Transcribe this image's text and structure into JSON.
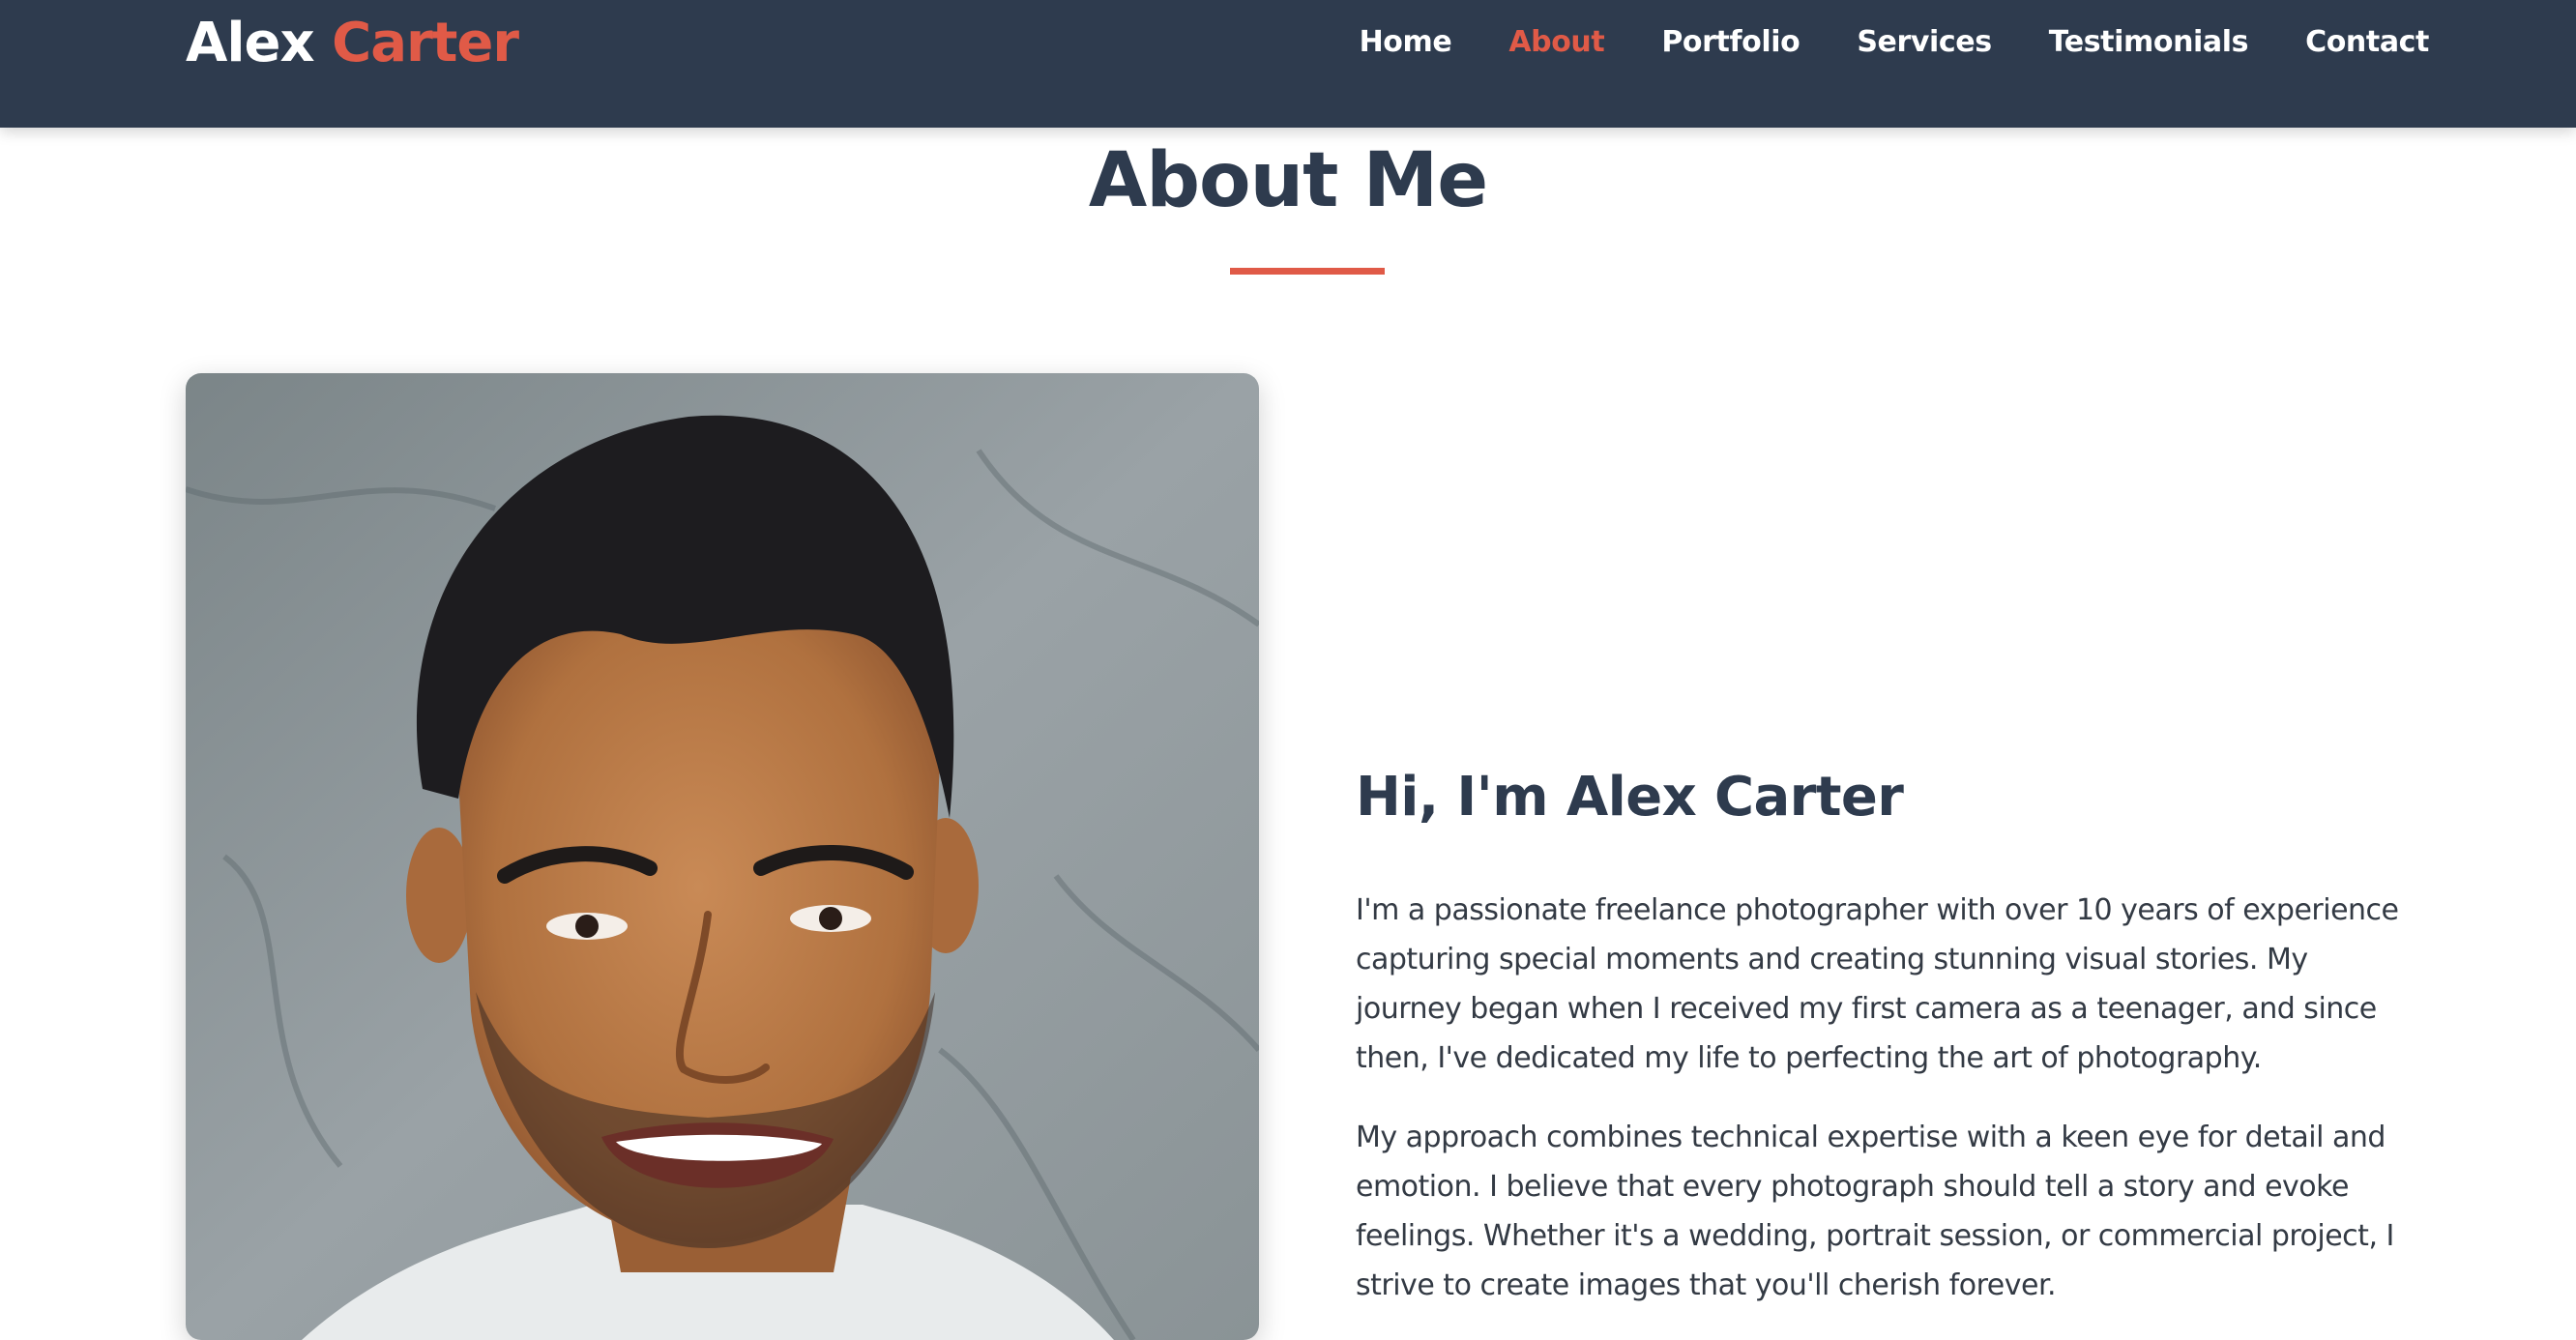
{
  "header": {
    "logo_first": "Alex",
    "logo_second": "Carter",
    "nav": [
      {
        "label": "Home"
      },
      {
        "label": "About",
        "active": true
      },
      {
        "label": "Portfolio"
      },
      {
        "label": "Services"
      },
      {
        "label": "Testimonials"
      },
      {
        "label": "Contact"
      }
    ]
  },
  "about": {
    "title": "About Me",
    "heading": "Hi, I'm Alex Carter",
    "paragraphs": [
      "I'm a passionate freelance photographer with over 10 years of experience capturing special moments and creating stunning visual stories. My journey began when I received my first camera as a teenager, and since then, I've dedicated my life to perfecting the art of photography.",
      "My approach combines technical expertise with a keen eye for detail and emotion. I believe that every photograph should tell a story and evoke feelings. Whether it's a wedding, portrait session, or commercial project, I strive to create images that you'll cherish forever."
    ]
  },
  "colors": {
    "navbar": "#2e3b4e",
    "accent": "#e05a47",
    "heading": "#2e3b4e",
    "body_text": "#333a44"
  }
}
